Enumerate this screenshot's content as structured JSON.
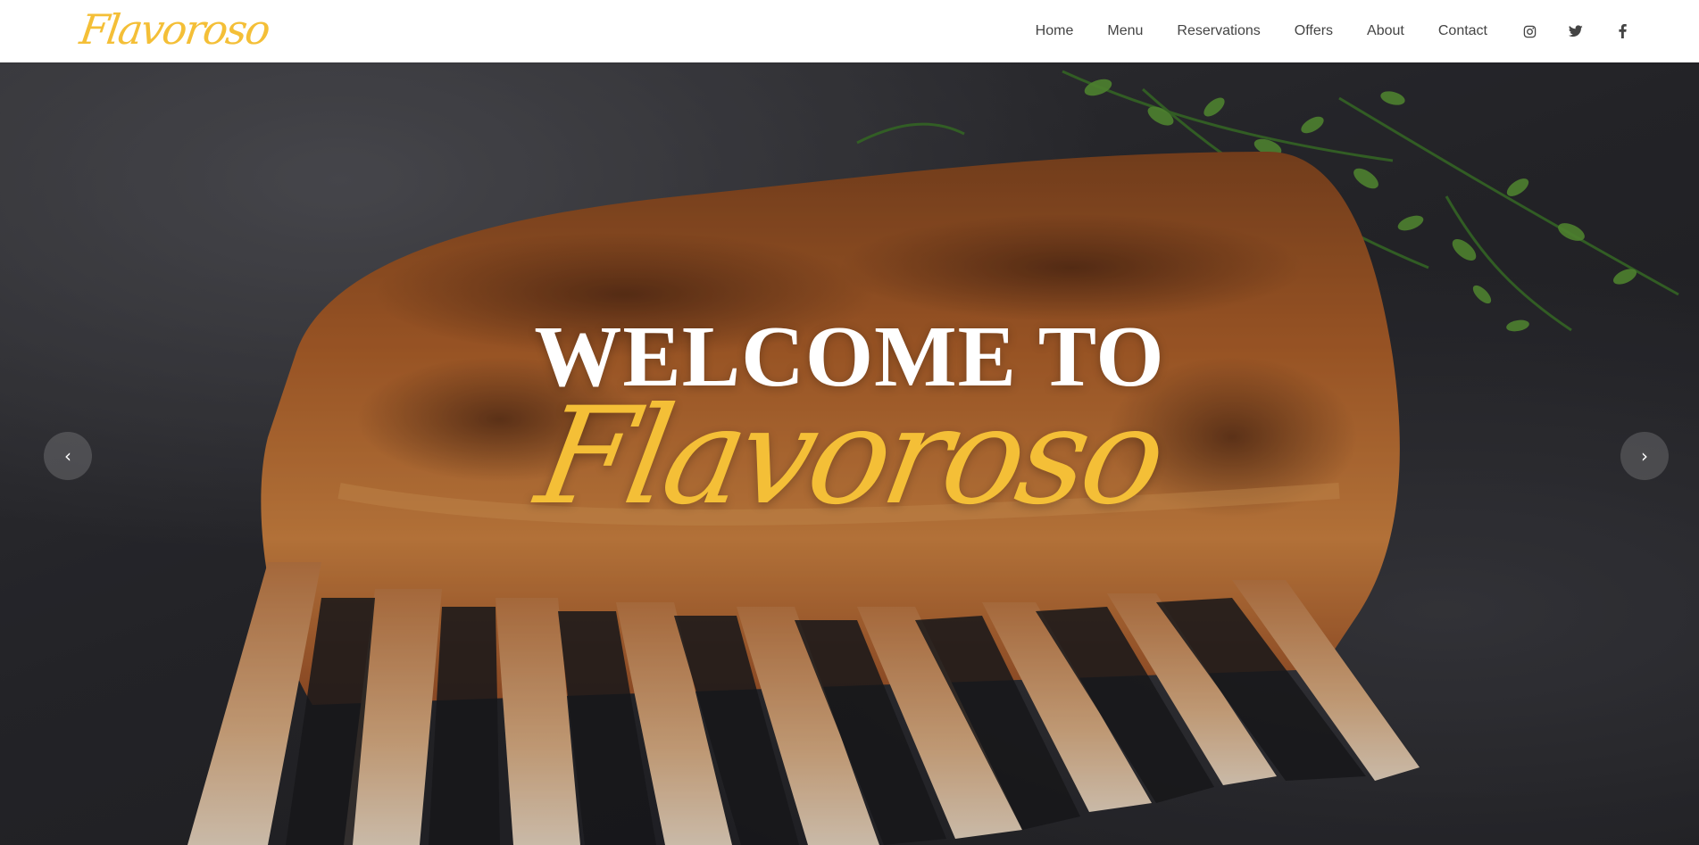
{
  "brand": {
    "name": "Flavoroso",
    "color": "#f4bf37"
  },
  "nav": {
    "links": [
      "Home",
      "Menu",
      "Reservations",
      "Offers",
      "About",
      "Contact"
    ],
    "social_icons": [
      "instagram-icon",
      "twitter-icon",
      "facebook-icon"
    ]
  },
  "hero": {
    "title": "WELCOME TO",
    "script_title": "Flavoroso",
    "prev_glyph": "‹",
    "next_glyph": "›",
    "image": "roasted-rack-of-lamb-with-herbs"
  },
  "colors": {
    "accent": "#f4bf37",
    "nav_text": "#444444",
    "header_bg": "#ffffff"
  }
}
